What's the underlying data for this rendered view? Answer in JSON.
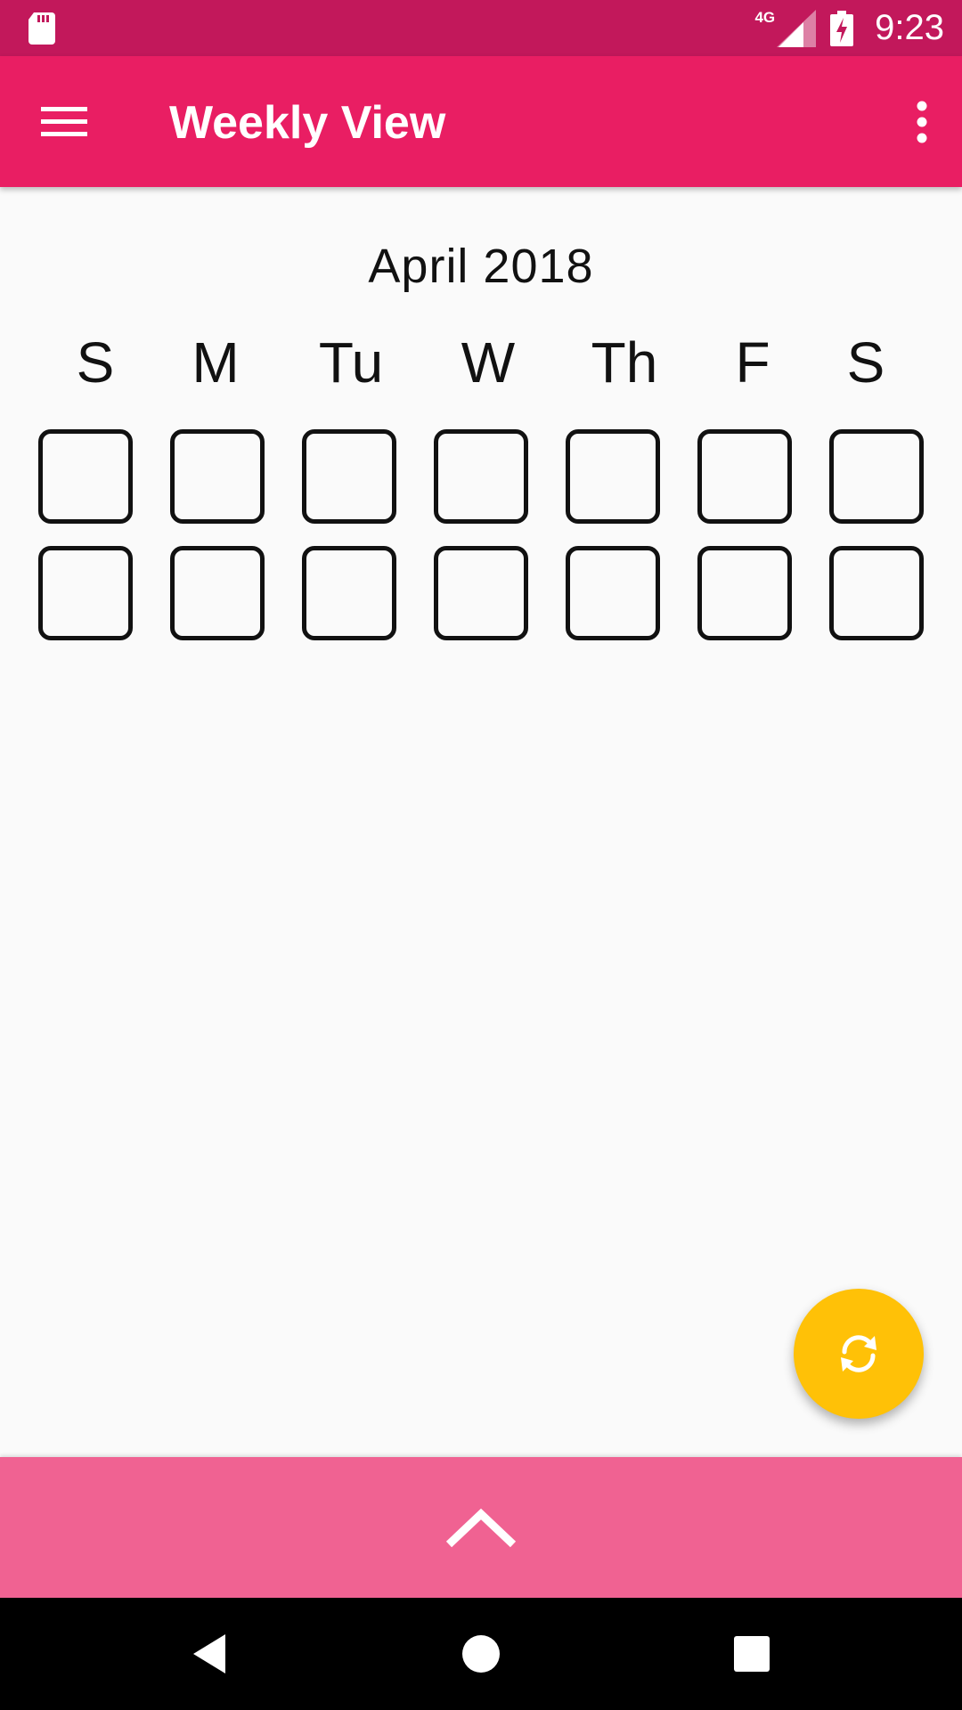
{
  "status_bar": {
    "time": "9:23",
    "network_type": "4G",
    "icons": [
      "sd-card-icon",
      "signal-icon",
      "battery-charging-icon"
    ]
  },
  "app_bar": {
    "title": "Weekly View",
    "menu_icon": "hamburger-menu-icon",
    "overflow_icon": "more-vert-icon"
  },
  "calendar": {
    "month_label": "April 2018",
    "weekdays": [
      "S",
      "M",
      "Tu",
      "W",
      "Th",
      "F",
      "S"
    ],
    "weeks": [
      [
        "",
        "",
        "",
        "",
        "",
        "",
        ""
      ],
      [
        "",
        "",
        "",
        "",
        "",
        "",
        ""
      ]
    ]
  },
  "fab": {
    "icon": "refresh-icon"
  },
  "bottom_sheet": {
    "icon": "chevron-up-icon"
  },
  "nav_bar": {
    "icons": [
      "back-icon",
      "home-icon",
      "recents-icon"
    ]
  },
  "colors": {
    "status_bar": "#c2185b",
    "app_bar": "#e91e63",
    "bottom_sheet": "#f06292",
    "fab": "#ffc107",
    "background": "#fafafa"
  }
}
